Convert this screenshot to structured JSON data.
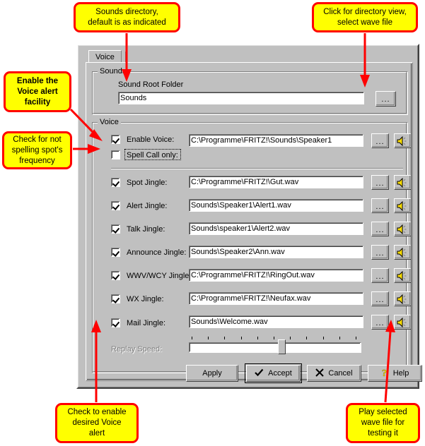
{
  "dialog": {
    "tab": {
      "label": "Voice"
    },
    "sounds_group": {
      "title": "Sounds",
      "root_label": "Sound Root Folder",
      "root_value": "Sounds",
      "browse_label": "..."
    },
    "voice_group": {
      "title": "Voice",
      "rows": [
        {
          "label": "Enable Voice:",
          "checked": true,
          "value": "C:\\Programme\\FRITZ!\\Sounds\\Speaker1",
          "browse": "...",
          "play_icon": "speaker-icon"
        },
        {
          "label": "Spell Call only:",
          "checked": false,
          "value": "",
          "browse": "",
          "play_icon": ""
        },
        {
          "label": "Spot Jingle:",
          "checked": true,
          "value": "C:\\Programme\\FRITZ!\\Gut.wav",
          "browse": "...",
          "play_icon": "speaker-icon"
        },
        {
          "label": "Alert Jingle:",
          "checked": true,
          "value": "Sounds\\Speaker1\\Alert1.wav",
          "browse": "...",
          "play_icon": "speaker-icon"
        },
        {
          "label": "Talk Jingle:",
          "checked": true,
          "value": "Sounds\\speaker1\\Alert2.wav",
          "browse": "...",
          "play_icon": "speaker-icon"
        },
        {
          "label": "Announce Jingle:",
          "checked": true,
          "value": "Sounds\\Speaker2\\Ann.wav",
          "browse": "...",
          "play_icon": "speaker-icon"
        },
        {
          "label": "WWV/WCY Jingle:",
          "checked": true,
          "value": "C:\\Programme\\FRITZ!\\RingOut.wav",
          "browse": "...",
          "play_icon": "speaker-icon"
        },
        {
          "label": "WX Jingle:",
          "checked": true,
          "value": "C:\\Programme\\FRITZ!\\Neufax.wav",
          "browse": "...",
          "play_icon": "speaker-icon"
        },
        {
          "label": "Mail Jingle:",
          "checked": true,
          "value": "Sounds\\Welcome.wav",
          "browse": "...",
          "play_icon": "speaker-icon"
        }
      ],
      "replay_speed_label": "Replay Speed:",
      "replay_speed_percent": 54,
      "replay_speed_ticks": 11
    },
    "buttons": {
      "apply": "Apply",
      "accept": "Accept",
      "cancel": "Cancel",
      "help": "Help"
    }
  },
  "annotations": [
    {
      "id": "sounds-directory",
      "text": "Sounds directory,\ndefault is as indicated",
      "bold": false
    },
    {
      "id": "directory-view",
      "text": "Click for directory view,\nselect wave file",
      "bold": false
    },
    {
      "id": "enable-voice",
      "text": "Enable the\nVoice alert\nfacility",
      "bold": true
    },
    {
      "id": "spell-call",
      "text": "Check for not\nspelling spot's\nfrequency",
      "bold": false
    },
    {
      "id": "enable-jingle",
      "text": "Check to enable\ndesired Voice\nalert",
      "bold": false
    },
    {
      "id": "play-wave",
      "text": "Play selected\nwave file for\ntesting it",
      "bold": false
    }
  ],
  "colors": {
    "callout_fill": "#ffff00",
    "callout_border": "#ff0000",
    "dialog_face": "#c0c0c0"
  }
}
